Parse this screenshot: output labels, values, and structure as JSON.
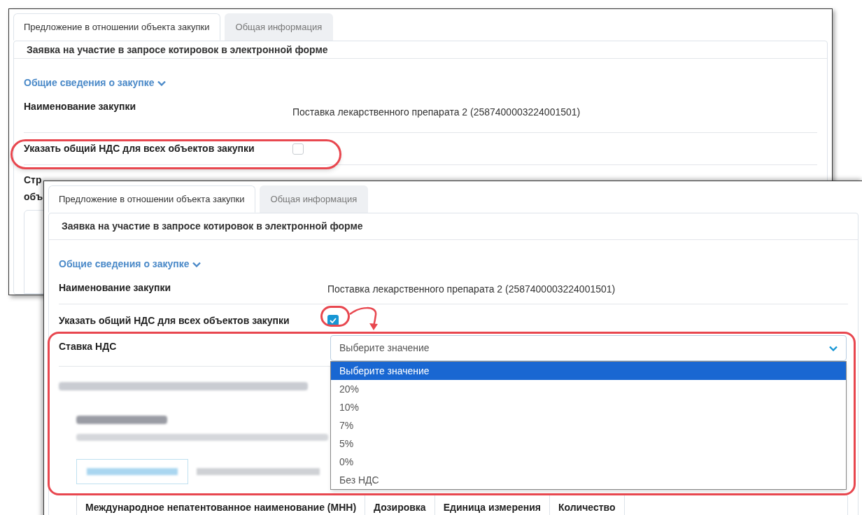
{
  "screens": [
    {
      "tabs": [
        {
          "label": "Предложение в отношении объекта закупки",
          "selected": true
        },
        {
          "label": "Общая информация",
          "selected": false
        }
      ],
      "form_title": "Заявка на участие в запросе котировок в электронной форме",
      "section_link": "Общие сведения о закупке",
      "purchase_name": {
        "label": "Наименование закупки",
        "value": "Поставка лекарственного препарата 2 (2587400003224001501)"
      },
      "vat_common": {
        "label": "Указать общий НДС для всех объектов закупки",
        "checked": false
      },
      "cut_label": [
        "Стр",
        "объ"
      ]
    },
    {
      "tabs": [
        {
          "label": "Предложение в отношении объекта закупки",
          "selected": true
        },
        {
          "label": "Общая информация",
          "selected": false
        }
      ],
      "form_title": "Заявка на участие в запросе котировок в электронной форме",
      "section_link": "Общие сведения о закупке",
      "purchase_name": {
        "label": "Наименование закупки",
        "value": "Поставка лекарственного препарата 2 (2587400003224001501)"
      },
      "vat_common": {
        "label": "Указать общий НДС для всех объектов закупки",
        "checked": true
      },
      "vat_rate": {
        "label": "Ставка НДС",
        "value": "Выберите значение",
        "expanded": true,
        "options": [
          {
            "label": "Выберите значение",
            "selected": true
          },
          {
            "label": "20%",
            "selected": false
          },
          {
            "label": "10%",
            "selected": false
          },
          {
            "label": "7%",
            "selected": false
          },
          {
            "label": "5%",
            "selected": false
          },
          {
            "label": "0%",
            "selected": false
          },
          {
            "label": "Без НДС",
            "selected": false
          }
        ]
      },
      "table_columns": [
        "Международное непатентованное наименование (МНН)",
        "Дозировка",
        "Единица измерения",
        "Количество"
      ]
    }
  ]
}
